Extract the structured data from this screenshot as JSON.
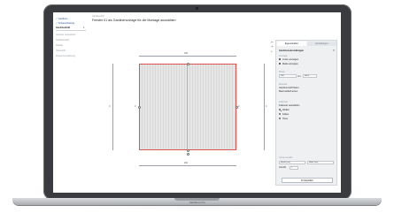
{
  "device": {
    "brand_label": "MacBook Pro"
  },
  "app": {
    "nav": {
      "items": [
        {
          "label": "✓ Gardinen"
        },
        {
          "label": "✓ Schiene/Stange"
        },
        {
          "label": "Gardinenbild"
        }
      ],
      "badge": "1",
      "sub_items": [
        {
          "label": "Gardine auswählen"
        },
        {
          "label": "Stoffauswahl"
        },
        {
          "label": "Details"
        },
        {
          "label": "Übersicht"
        },
        {
          "label": "Zusammenfassung"
        }
      ]
    },
    "breadcrumb": "Gardinenbild",
    "title": "Fenster 01 als Gardinenvorlage für die Montage auswählen",
    "canvas": {
      "top_dimension": "200",
      "bottom_dimension": "200",
      "left_dimension": "0",
      "right_dimension": "0",
      "mid_left_label": "0",
      "mid_right_label": "0"
    },
    "panel": {
      "tabs": [
        {
          "label": "Eigenschaften"
        },
        {
          "label": "Einstellungen"
        }
      ],
      "heading": "Gardineneinstellungen",
      "close_icon": "×",
      "group1": {
        "title": "Anzeige",
        "options": [
          {
            "label": "Linien anzeigen"
          },
          {
            "label": "Maße anzeigen"
          }
        ]
      },
      "group2": {
        "title": "Breite",
        "value": "200",
        "unit": "cm",
        "extra": "Hoch"
      },
      "group3": {
        "title": "Material",
        "line1": "Gardinenstoff Natur",
        "line2": "Baumwolle/Leinen"
      },
      "group4": {
        "title": "Faltenart",
        "subtitle": "Faltenart auswählen",
        "options": [
          {
            "label": "Wellen"
          },
          {
            "label": "Falten"
          },
          {
            "label": "Ösen"
          }
        ]
      },
      "group5": {
        "title": "Gesamtmaße",
        "field1": "Breite (cm)",
        "field2": "Höhe (cm)",
        "field3": "Anzahl",
        "field4": "1"
      },
      "button_label": "Fertigstellen"
    },
    "side_icons": [
      {
        "name": "undo-icon"
      },
      {
        "name": "redo-icon"
      },
      {
        "name": "zoom-icon"
      }
    ]
  }
}
